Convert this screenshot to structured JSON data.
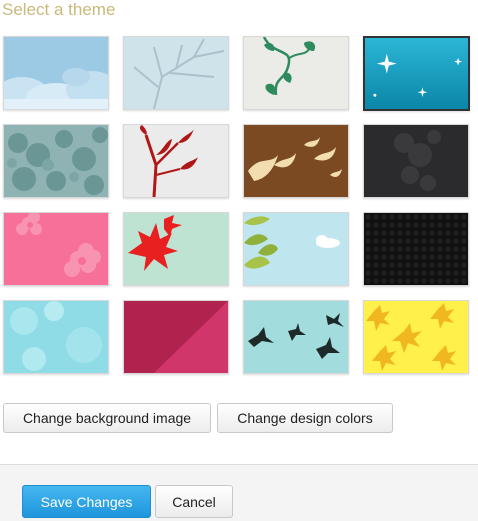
{
  "dialog": {
    "title": "Select a theme"
  },
  "themes": [
    {
      "name": "clouds",
      "selected": false
    },
    {
      "name": "bare-tree",
      "selected": false
    },
    {
      "name": "green-vine",
      "selected": false
    },
    {
      "name": "sparkles",
      "selected": true
    },
    {
      "name": "foliage-silhouette",
      "selected": false
    },
    {
      "name": "red-branch",
      "selected": false
    },
    {
      "name": "flying-birds-brown",
      "selected": false
    },
    {
      "name": "dark-texture",
      "selected": false
    },
    {
      "name": "pink-flowers",
      "selected": false
    },
    {
      "name": "red-leaves",
      "selected": false
    },
    {
      "name": "green-leaves-sky",
      "selected": false
    },
    {
      "name": "black-hexagons",
      "selected": false
    },
    {
      "name": "light-blue-bokeh",
      "selected": false
    },
    {
      "name": "magenta-diagonal",
      "selected": false
    },
    {
      "name": "black-birds",
      "selected": false
    },
    {
      "name": "yellow-maple-leaves",
      "selected": false
    }
  ],
  "actions": {
    "change_background_label": "Change background image",
    "change_colors_label": "Change design colors"
  },
  "footer": {
    "save_label": "Save Changes",
    "cancel_label": "Cancel"
  },
  "colors": {
    "title": "#c9b97a",
    "primary": "#2aa3e6",
    "selected_border": "#333333"
  }
}
